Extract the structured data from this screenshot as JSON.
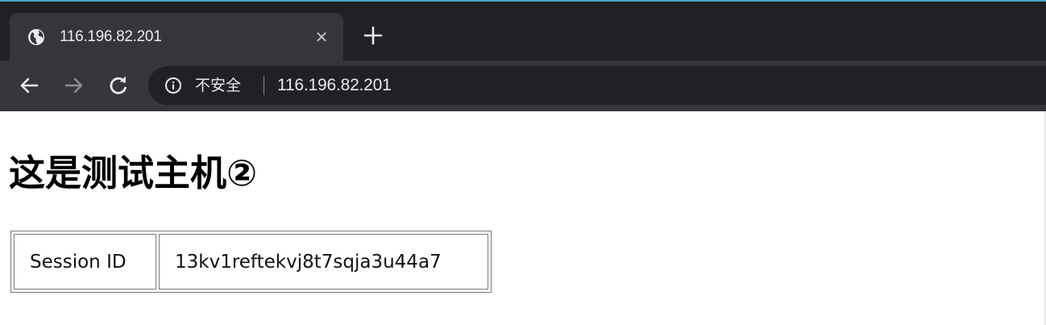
{
  "tab": {
    "title": "116.196.82.201",
    "close_glyph": "✕",
    "favicon_icon": "globe-icon",
    "new_tab_icon": "plus-icon"
  },
  "toolbar": {
    "back_icon": "arrow-left-icon",
    "forward_icon": "arrow-right-icon",
    "reload_icon": "reload-icon",
    "security_icon": "info-icon",
    "security_label": "不安全",
    "url": "116.196.82.201"
  },
  "page": {
    "heading": "这是测试主机②",
    "table": {
      "rows": [
        {
          "key": "Session ID",
          "value": "13kv1reftekvj8t7sqja3u44a7"
        }
      ]
    }
  },
  "colors": {
    "tab_strip": "#202124",
    "toolbar": "#35363a",
    "omnibox": "#202124",
    "text_light": "#e8eaed",
    "accent_line": "#4aa3c8"
  }
}
